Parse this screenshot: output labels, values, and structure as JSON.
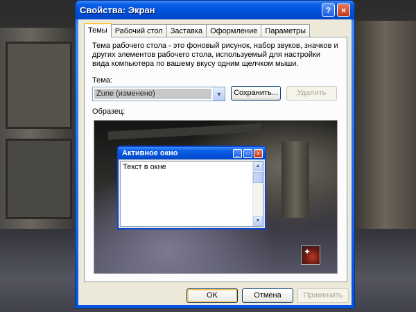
{
  "window": {
    "title": "Свойства: Экран",
    "help_label": "?",
    "close_label": "×"
  },
  "tabs": [
    {
      "label": "Темы",
      "active": true
    },
    {
      "label": "Рабочий стол"
    },
    {
      "label": "Заставка"
    },
    {
      "label": "Оформление"
    },
    {
      "label": "Параметры"
    }
  ],
  "themes": {
    "description": "Тема рабочего стола - это фоновый рисунок, набор звуков, значков и других элементов рабочего стола, используемый для настройки вида компьютера по вашему вкусу одним щелчком мыши.",
    "theme_label": "Тема:",
    "theme_value": "Zune (изменено)",
    "save_label": "Сохранить...",
    "delete_label": "Удалить",
    "sample_label": "Образец:"
  },
  "preview": {
    "window_title": "Активное окно",
    "window_text": "Текст в окне"
  },
  "footer": {
    "ok_label": "OK",
    "cancel_label": "Отмена",
    "apply_label": "Применить"
  },
  "colors": {
    "titlebar": "#0058ee",
    "accent_tab": "#ffc83c",
    "dialog_bg": "#ece9d8"
  }
}
